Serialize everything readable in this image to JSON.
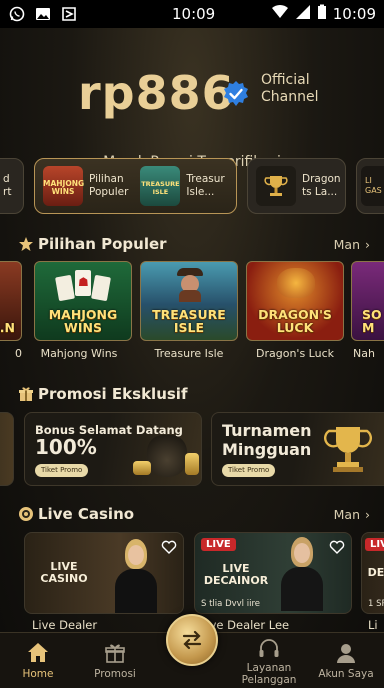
{
  "status_bar": {
    "time_left": "10:09",
    "time_right": "10:09"
  },
  "header": {
    "brand": "rp886",
    "official_line1": "Official",
    "official_line2": "Channel",
    "tagline": "Merek Resmi Terverifikasi"
  },
  "chips": [
    {
      "label_l1": "d",
      "label_l2": "rt"
    },
    {
      "label_l1": "Pilihan",
      "label_l2": "Populer"
    },
    {
      "label_l1": "Treasur",
      "label_l2": "Isle..."
    },
    {
      "label_l1": "Dragon",
      "label_l2": "ts La..."
    },
    {
      "label_l1": "LI",
      "label_l2": "GAS"
    }
  ],
  "sections": {
    "popular": {
      "title": "Pilihan Populer",
      "more": "Man"
    },
    "promo": {
      "title": "Promosi Eksklusif"
    },
    "live": {
      "title": "Live Casino",
      "more": "Man"
    }
  },
  "games": [
    {
      "name": "0",
      "logo": "..N"
    },
    {
      "name": "Mahjong Wins",
      "logo_l1": "MAHJONG",
      "logo_l2": "WINS"
    },
    {
      "name": "Treasure Isle",
      "logo_l1": "TREASURE",
      "logo_l2": "ISLE"
    },
    {
      "name": "Dragon's Luck",
      "logo_l1": "DRAGON'S",
      "logo_l2": "LUCK"
    },
    {
      "name": "Nah",
      "logo_l1": "SO",
      "logo_l2": "M"
    }
  ],
  "promos": [
    {
      "title": "Bonus Selamat Datang",
      "big": "100%",
      "button": "Tiket Promo"
    },
    {
      "title": "Turnamen",
      "title2": "Mingguan",
      "button": "Tiket Promo"
    }
  ],
  "live": [
    {
      "name": "Live Dealer",
      "label_l1": "LIVE",
      "label_l2": "CASINO"
    },
    {
      "name": "Live Dealer Lee",
      "badge": "LIVE",
      "label_l1": "LIVE",
      "label_l2": "DECAINOR",
      "caption": "S tlia Dvvl iire"
    },
    {
      "name": "Li",
      "badge": "LIVE",
      "label_l1": "DE",
      "caption": "1 SR"
    }
  ],
  "nav": [
    {
      "label": "Home",
      "icon": "home-icon"
    },
    {
      "label": "Promosi",
      "icon": "gift-icon"
    },
    {
      "label": "Layanan",
      "label2": "Pelanggan",
      "icon": "headset-icon"
    },
    {
      "label": "Akun Saya",
      "icon": "user-icon"
    }
  ],
  "colors": {
    "gold": "#e9cf97",
    "accent": "#b89556",
    "live_red": "#c8282a"
  }
}
